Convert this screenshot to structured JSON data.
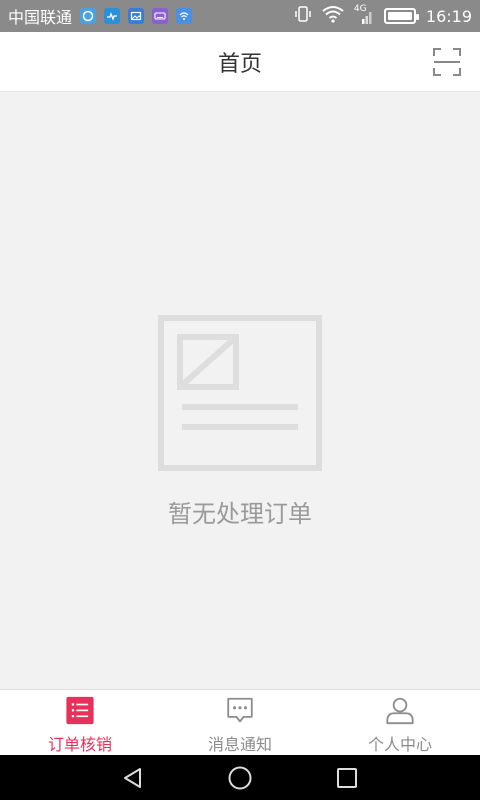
{
  "status_bar": {
    "carrier": "中国联通",
    "network": "4G",
    "time": "16:19",
    "icons": [
      "browser-icon",
      "health-icon",
      "gallery-icon",
      "keyboard-icon",
      "wifi-app-icon"
    ],
    "icon_colors": [
      "#4aa3e0",
      "#2a90d9",
      "#3a7bd5",
      "#8a5fd0",
      "#4a90e2"
    ]
  },
  "header": {
    "title": "首页"
  },
  "empty_state": {
    "message": "暂无处理订单"
  },
  "tabs": [
    {
      "label": "订单核销",
      "icon": "list-icon",
      "active": true
    },
    {
      "label": "消息通知",
      "icon": "message-icon",
      "active": false
    },
    {
      "label": "个人中心",
      "icon": "person-icon",
      "active": false
    }
  ],
  "colors": {
    "accent": "#e6325a",
    "status_bar": "#8a8a8a",
    "background": "#f2f2f2",
    "empty_text": "#9a9a9a"
  }
}
